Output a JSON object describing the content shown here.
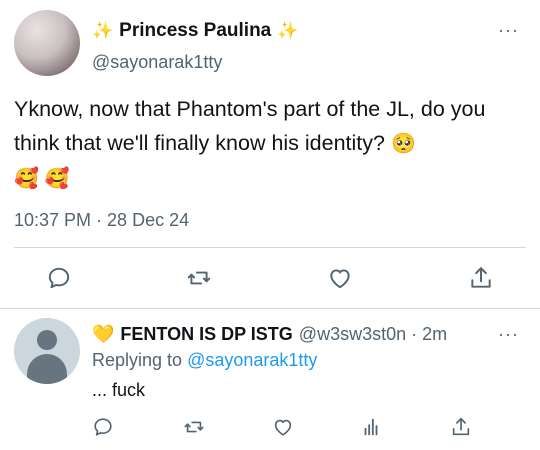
{
  "tweet": {
    "display_name": "Princess Paulina",
    "name_prefix_emoji": "✨",
    "name_suffix_emoji": "✨",
    "handle": "@sayonarak1tty",
    "more": "···",
    "text": "Yknow, now that Phantom's part of the JL, do you think that we'll finally know his identity?",
    "emojis": [
      "🥺",
      "🥰",
      "🥰"
    ],
    "timestamp": "10:37 PM · 28 Dec 24",
    "actions": [
      "reply-icon",
      "retweet-icon",
      "like-icon",
      "share-icon"
    ]
  },
  "reply": {
    "heart_emoji": "💛",
    "display_name": "FENTON IS DP ISTG",
    "handle_time": "@w3sw3st0n · 2m",
    "more": "···",
    "replying_label": "Replying to",
    "replying_handle": "@sayonarak1tty",
    "text": "... fuck",
    "actions": [
      "reply-icon",
      "retweet-icon",
      "like-icon",
      "analytics-icon",
      "share-icon"
    ]
  },
  "colors": {
    "text": "#0f1419",
    "secondary": "#536471",
    "link": "#1d9bf0",
    "divider": "#cfd9de",
    "sparkle": "#f2c94c"
  }
}
